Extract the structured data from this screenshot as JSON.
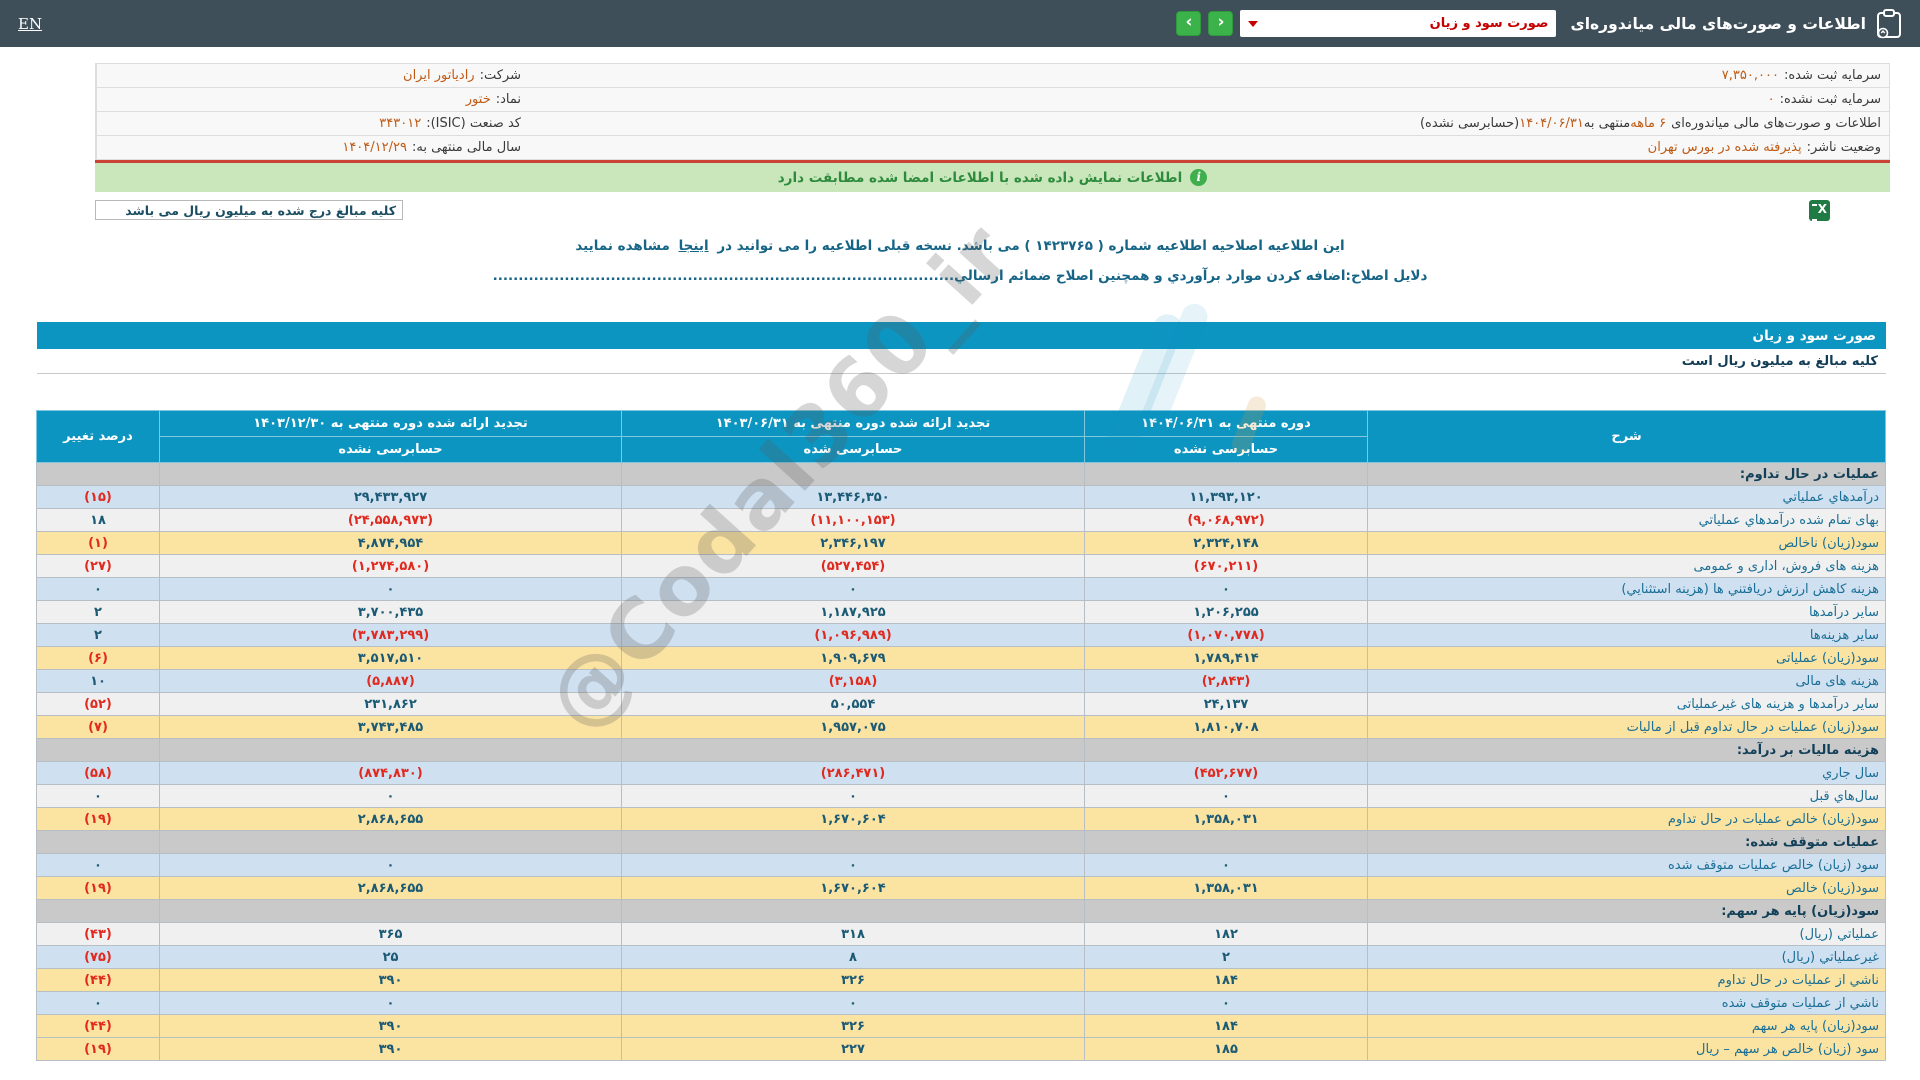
{
  "topbar": {
    "title": "اطلاعات و صورت‌های مالی میاندوره‌ای",
    "report_select_value": "صورت سود و زیان",
    "nav_next": "›",
    "nav_prev": "‹",
    "language_link": "EN"
  },
  "company": {
    "company_label": "شرکت:",
    "company_value": "رادیاتور ایران",
    "symbol_label": "نماد:",
    "symbol_value": "ختور",
    "isic_label": "کد صنعت (ISIC):",
    "isic_value": "۳۴۳۰۱۲",
    "fiscal_year_label": "سال مالی منتهی به:",
    "fiscal_year_value": "۱۴۰۴/۱۲/۲۹",
    "registered_capital_label": "سرمایه ثبت شده:",
    "registered_capital_value": "۷,۳۵۰,۰۰۰",
    "unregistered_capital_label": "سرمایه ثبت نشده:",
    "unregistered_capital_value": "۰",
    "period_prefix": "اطلاعات و صورت‌های مالی میاندوره‌ای",
    "period_term": "۶ ماهه",
    "period_middle": "منتهی به",
    "period_date": "۱۴۰۴/۰۶/۳۱",
    "period_suffix": "(حسابرسی نشده)",
    "issuer_status_label": "وضعیت ناشر:",
    "issuer_status_value": "پذیرفته شده در بورس تهران"
  },
  "notices": {
    "signature_notice": "اطلاعات نمایش داده شده با اطلاعات امضا شده مطابقت دارد",
    "amounts_box": "کلیه مبالغ درج شده به میلیون ریال می باشد",
    "amendment_pre": "این اطلاعیه اصلاحیه اطلاعیه شماره ( ۱۴۲۳۷۶۵ ) می باشد. نسخه قبلی اطلاعیه را می توانید در",
    "amendment_link": "اینجا",
    "amendment_post": "مشاهده نمایید",
    "amendment_reason": "دلایل اصلاح:اضافه کردن موارد برآوردي و همچنین اصلاح ضمائم ارسالي",
    "amendment_dots": ".........................................................................................."
  },
  "section": {
    "title": "صورت سود و زیان",
    "subtitle": "کلیه مبالغ به میلیون ریال است"
  },
  "watermark": "@Codal360_ir",
  "table": {
    "header": {
      "col_desc": "شرح",
      "col_current_line1": "دوره منتهی به ۱۴۰۴/۰۶/۳۱",
      "col_current_line2": "حسابرسی نشده",
      "col_restated6_line1": "تجدید ارائه شده دوره منتهی به ۱۴۰۳/۰۶/۳۱",
      "col_restated6_line2": "حسابرسی شده",
      "col_restated12_line1": "تجدید ارائه شده دوره منتهی به ۱۴۰۳/۱۲/۳۰",
      "col_restated12_line2": "حسابرسی نشده",
      "col_change": "درصد تغییر"
    },
    "rows": [
      {
        "type": "section",
        "label": "عملیات در حال تداوم:",
        "v_current": "",
        "v_restated6": "",
        "v_restated12": "",
        "change": ""
      },
      {
        "type": "data",
        "bg": "blue",
        "label": "درآمدهاي عملياتي",
        "v_current": "۱۱,۳۹۳,۱۲۰",
        "v_restated6": "۱۳,۴۴۶,۳۵۰",
        "v_restated12": "۲۹,۴۳۳,۹۲۷",
        "change": "(۱۵)"
      },
      {
        "type": "data",
        "bg": "gray",
        "label": "بهای تمام شده درآمدهاي عملياتي",
        "v_current": "(۹,۰۶۸,۹۷۲)",
        "v_restated6": "(۱۱,۱۰۰,۱۵۳)",
        "v_restated12": "(۲۴,۵۵۸,۹۷۳)",
        "change": "۱۸"
      },
      {
        "type": "data",
        "bg": "yellow",
        "label": "سود(زیان) ناخالص",
        "v_current": "۲,۳۲۴,۱۴۸",
        "v_restated6": "۲,۳۴۶,۱۹۷",
        "v_restated12": "۴,۸۷۴,۹۵۴",
        "change": "(۱)"
      },
      {
        "type": "data",
        "bg": "gray",
        "label": "هزینه های فروش، اداری و عمومی",
        "v_current": "(۶۷۰,۲۱۱)",
        "v_restated6": "(۵۲۷,۴۵۴)",
        "v_restated12": "(۱,۲۷۴,۵۸۰)",
        "change": "(۲۷)"
      },
      {
        "type": "data",
        "bg": "blue",
        "label": "هزینه کاهش ارزش دریافتني ها (هزینه استثنايي)",
        "v_current": "۰",
        "v_restated6": "۰",
        "v_restated12": "۰",
        "change": "۰"
      },
      {
        "type": "data",
        "bg": "gray",
        "label": "سایر درآمدها",
        "v_current": "۱,۲۰۶,۲۵۵",
        "v_restated6": "۱,۱۸۷,۹۲۵",
        "v_restated12": "۳,۷۰۰,۴۳۵",
        "change": "۲"
      },
      {
        "type": "data",
        "bg": "blue",
        "label": "سایر هزینه‌ها",
        "v_current": "(۱,۰۷۰,۷۷۸)",
        "v_restated6": "(۱,۰۹۶,۹۸۹)",
        "v_restated12": "(۳,۷۸۳,۲۹۹)",
        "change": "۲"
      },
      {
        "type": "data",
        "bg": "yellow",
        "label": "سود(زیان) عملیاتی",
        "v_current": "۱,۷۸۹,۴۱۴",
        "v_restated6": "۱,۹۰۹,۶۷۹",
        "v_restated12": "۳,۵۱۷,۵۱۰",
        "change": "(۶)"
      },
      {
        "type": "data",
        "bg": "blue",
        "label": "هزینه های مالی",
        "v_current": "(۲,۸۴۳)",
        "v_restated6": "(۳,۱۵۸)",
        "v_restated12": "(۵,۸۸۷)",
        "change": "۱۰"
      },
      {
        "type": "data",
        "bg": "gray",
        "label": "سایر درآمدها و هزینه های غیرعملیاتی",
        "v_current": "۲۴,۱۳۷",
        "v_restated6": "۵۰,۵۵۴",
        "v_restated12": "۲۳۱,۸۶۲",
        "change": "(۵۲)"
      },
      {
        "type": "data",
        "bg": "yellow",
        "label": "سود(زیان) عملیات در حال تداوم قبل از مالیات",
        "v_current": "۱,۸۱۰,۷۰۸",
        "v_restated6": "۱,۹۵۷,۰۷۵",
        "v_restated12": "۳,۷۴۳,۴۸۵",
        "change": "(۷)"
      },
      {
        "type": "section",
        "label": "هزینه مالیات بر درآمد:",
        "v_current": "",
        "v_restated6": "",
        "v_restated12": "",
        "change": ""
      },
      {
        "type": "data",
        "bg": "blue",
        "label": "سال جاري",
        "v_current": "(۴۵۲,۶۷۷)",
        "v_restated6": "(۲۸۶,۴۷۱)",
        "v_restated12": "(۸۷۴,۸۳۰)",
        "change": "(۵۸)"
      },
      {
        "type": "data",
        "bg": "gray",
        "label": "سال‌هاي قبل",
        "v_current": "۰",
        "v_restated6": "۰",
        "v_restated12": "۰",
        "change": "۰"
      },
      {
        "type": "data",
        "bg": "yellow",
        "label": "سود(زیان) خالص عملیات در حال تداوم",
        "v_current": "۱,۳۵۸,۰۳۱",
        "v_restated6": "۱,۶۷۰,۶۰۴",
        "v_restated12": "۲,۸۶۸,۶۵۵",
        "change": "(۱۹)"
      },
      {
        "type": "section",
        "label": "عملیات متوقف شده:",
        "v_current": "",
        "v_restated6": "",
        "v_restated12": "",
        "change": ""
      },
      {
        "type": "data",
        "bg": "blue",
        "label": "سود (زیان) خالص عملیات متوقف شده",
        "v_current": "۰",
        "v_restated6": "۰",
        "v_restated12": "۰",
        "change": "۰"
      },
      {
        "type": "data",
        "bg": "yellow",
        "label": "سود(زیان) خالص",
        "v_current": "۱,۳۵۸,۰۳۱",
        "v_restated6": "۱,۶۷۰,۶۰۴",
        "v_restated12": "۲,۸۶۸,۶۵۵",
        "change": "(۱۹)"
      },
      {
        "type": "section",
        "label": "سود(زیان) پایه هر سهم:",
        "v_current": "",
        "v_restated6": "",
        "v_restated12": "",
        "change": ""
      },
      {
        "type": "data",
        "bg": "gray",
        "label": "عملیاتي (ریال)",
        "v_current": "۱۸۲",
        "v_restated6": "۳۱۸",
        "v_restated12": "۳۶۵",
        "change": "(۴۳)"
      },
      {
        "type": "data",
        "bg": "blue",
        "label": "غیرعملیاتي (ریال)",
        "v_current": "۲",
        "v_restated6": "۸",
        "v_restated12": "۲۵",
        "change": "(۷۵)"
      },
      {
        "type": "data",
        "bg": "yellow",
        "label": "ناشي از عملیات در حال تداوم",
        "v_current": "۱۸۴",
        "v_restated6": "۳۲۶",
        "v_restated12": "۳۹۰",
        "change": "(۴۴)"
      },
      {
        "type": "data",
        "bg": "blue",
        "label": "ناشي از عملیات متوقف شده",
        "v_current": "۰",
        "v_restated6": "۰",
        "v_restated12": "۰",
        "change": "۰"
      },
      {
        "type": "data",
        "bg": "yellow",
        "label": "سود(زیان) پایه هر سهم",
        "v_current": "۱۸۴",
        "v_restated6": "۳۲۶",
        "v_restated12": "۳۹۰",
        "change": "(۴۴)"
      },
      {
        "type": "data",
        "bg": "yellow",
        "label": "سود (زیان) خالص هر سهم – ریال",
        "v_current": "۱۸۵",
        "v_restated6": "۲۲۷",
        "v_restated12": "۳۹۰",
        "change": "(۱۹)"
      }
    ]
  },
  "colors": {
    "topbar": "#3e4f59",
    "accent_teal": "#0d95c1",
    "nav_green": "#3cb24a",
    "divider_red": "#cb4335",
    "banner_green": "#c9e7bb",
    "row_blue": "#cfe0f1",
    "row_yellow": "#fbe3a2",
    "row_section": "#c9c9c9",
    "negative_red": "#e02a1f",
    "value_orange": "#bf5a15",
    "number_teal": "#1b5a74"
  }
}
